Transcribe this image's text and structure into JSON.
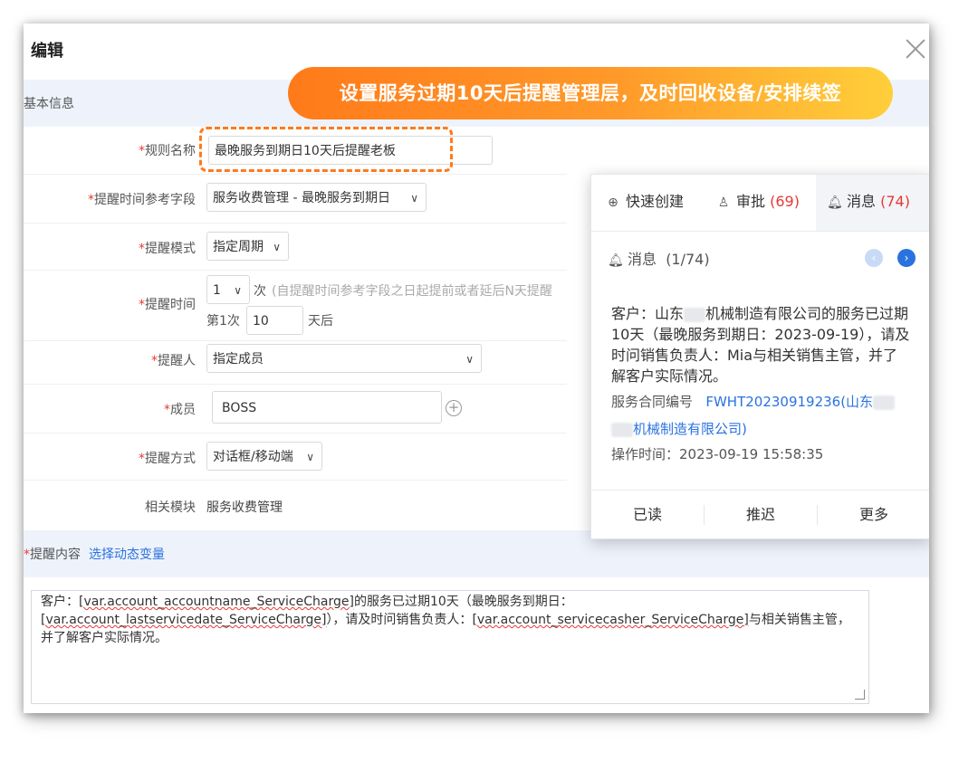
{
  "dialog": {
    "title": "编辑"
  },
  "banner": {
    "text": "设置服务过期10天后提醒管理层，及时回收设备/安排续签"
  },
  "sections": {
    "basic": "基本信息"
  },
  "form": {
    "rule_name": {
      "label": "规则名称",
      "value": "最晚服务到期日10天后提醒老板"
    },
    "ref_field": {
      "label": "提醒时间参考字段",
      "value": "服务收费管理 - 最晚服务到期日"
    },
    "mode": {
      "label": "提醒模式",
      "value": "指定周期"
    },
    "time": {
      "label": "提醒时间",
      "count": "1",
      "count_unit": "次",
      "hint": "(自提醒时间参考字段之日起提前或者延后N天提醒",
      "first_label": "第1次",
      "first_value": "10",
      "first_unit": "天后"
    },
    "reminder": {
      "label": "提醒人",
      "value": "指定成员"
    },
    "member": {
      "label": "成员",
      "value": "BOSS"
    },
    "method": {
      "label": "提醒方式",
      "value": "对话框/移动端"
    },
    "module": {
      "label": "相关模块",
      "value": "服务收费管理"
    }
  },
  "content": {
    "label": "提醒内容",
    "link": "选择动态变量",
    "text_parts": {
      "p1": "客户：",
      "v1": "[var.account_accountname_ServiceCharge]",
      "p2": "的服务已过期10天（最晚服务到期日：",
      "v2": "[var.account_lastservicedate_ServiceCharge]",
      "p3": "），请及时问销售负责人：",
      "v3": "[var.account_servicecasher_ServiceCharge]",
      "p4": "与相关销售主管，并了解客户实际情况。"
    }
  },
  "popup": {
    "tabs": [
      {
        "label": "快速创建",
        "icon": "plus-circle-icon"
      },
      {
        "label": "审批",
        "count": "(69)",
        "icon": "user-icon"
      },
      {
        "label": "消息",
        "count": "(74)",
        "icon": "bell-icon"
      }
    ],
    "header": {
      "title": "消息",
      "counter": "(1/74)"
    },
    "message": {
      "line_a": "客户：山东",
      "line_b": "机械制造有限公司的服务已过期10天（最晚服务到期日：2023-09-19），请及时问销售负责人：Mia与相关销售主管，并了解客户实际情况。"
    },
    "contract": {
      "label": "服务合同编号",
      "value_a": "FWHT20230919236(山东",
      "value_b": "机械制造有限公司)"
    },
    "op_time": "操作时间：2023-09-19 15:58:35",
    "footer": [
      "已读",
      "推迟",
      "更多"
    ]
  }
}
